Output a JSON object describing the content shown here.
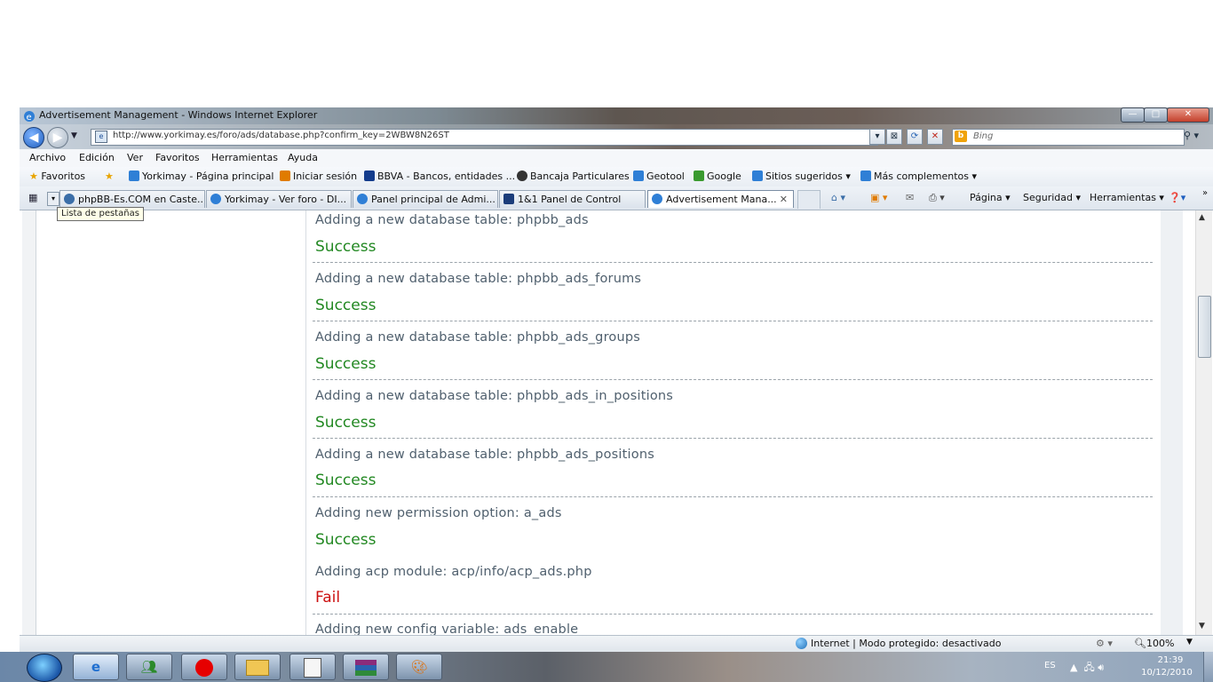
{
  "window": {
    "title": "Advertisement Management - Windows Internet Explorer",
    "min_glyph": "—",
    "max_glyph": "□",
    "close_glyph": "✕"
  },
  "address": {
    "url": "http://www.yorkimay.es/foro/ads/database.php?confirm_key=2WBW8N26ST",
    "search_placeholder": "Bing"
  },
  "menu": [
    "Archivo",
    "Edición",
    "Ver",
    "Favoritos",
    "Herramientas",
    "Ayuda"
  ],
  "favorites": {
    "favorites_label": "Favoritos",
    "links": [
      {
        "label": "Yorkimay - Página principal",
        "color": "#2f7fd6"
      },
      {
        "label": "Iniciar sesión",
        "color": "#e07b00"
      },
      {
        "label": "BBVA - Bancos, entidades ...",
        "color": "#143c8c"
      },
      {
        "label": "Bancaja Particulares",
        "color": "#333333"
      },
      {
        "label": "Geotool",
        "color": "#2f7fd6"
      },
      {
        "label": "Google",
        "color": "#3a9a2f"
      },
      {
        "label": "Sitios sugeridos ▾",
        "color": "#2f7fd6"
      },
      {
        "label": "Más complementos ▾",
        "color": "#2f7fd6"
      }
    ]
  },
  "tabs": [
    {
      "label": "phpBB-Es.COM en Caste..."
    },
    {
      "label": "Yorkimay - Ver foro - DI..."
    },
    {
      "label": "Panel principal de Admi..."
    },
    {
      "label": "1&1 Panel de Control"
    },
    {
      "label": "Advertisement Mana..."
    }
  ],
  "tooltip": "Lista de pestañas",
  "commands": {
    "pagina": "Página ▾",
    "seguridad": "Seguridad ▾",
    "herramientas": "Herramientas ▾",
    "help": "❓▾"
  },
  "results": [
    {
      "line": "Adding a new database table: phpbb_ads",
      "status": "Success"
    },
    {
      "line": "Adding a new database table: phpbb_ads_forums",
      "status": "Success"
    },
    {
      "line": "Adding a new database table: phpbb_ads_groups",
      "status": "Success"
    },
    {
      "line": "Adding a new database table: phpbb_ads_in_positions",
      "status": "Success"
    },
    {
      "line": "Adding a new database table: phpbb_ads_positions",
      "status": "Success"
    },
    {
      "line": "Adding new permission option: a_ads",
      "status": "Success"
    },
    {
      "line": "Adding acp module: acp/info/acp_ads.php",
      "status": "Fail"
    },
    {
      "line": "Adding new config variable: ads_enable",
      "status": ""
    }
  ],
  "statusbar": {
    "zone": "Internet | Modo protegido: desactivado",
    "zoom": "100%"
  },
  "taskbar": {
    "lang": "ES",
    "time": "21:39",
    "date": "10/12/2010"
  },
  "colors": {
    "success": "#228822",
    "fail": "#cc1111"
  }
}
